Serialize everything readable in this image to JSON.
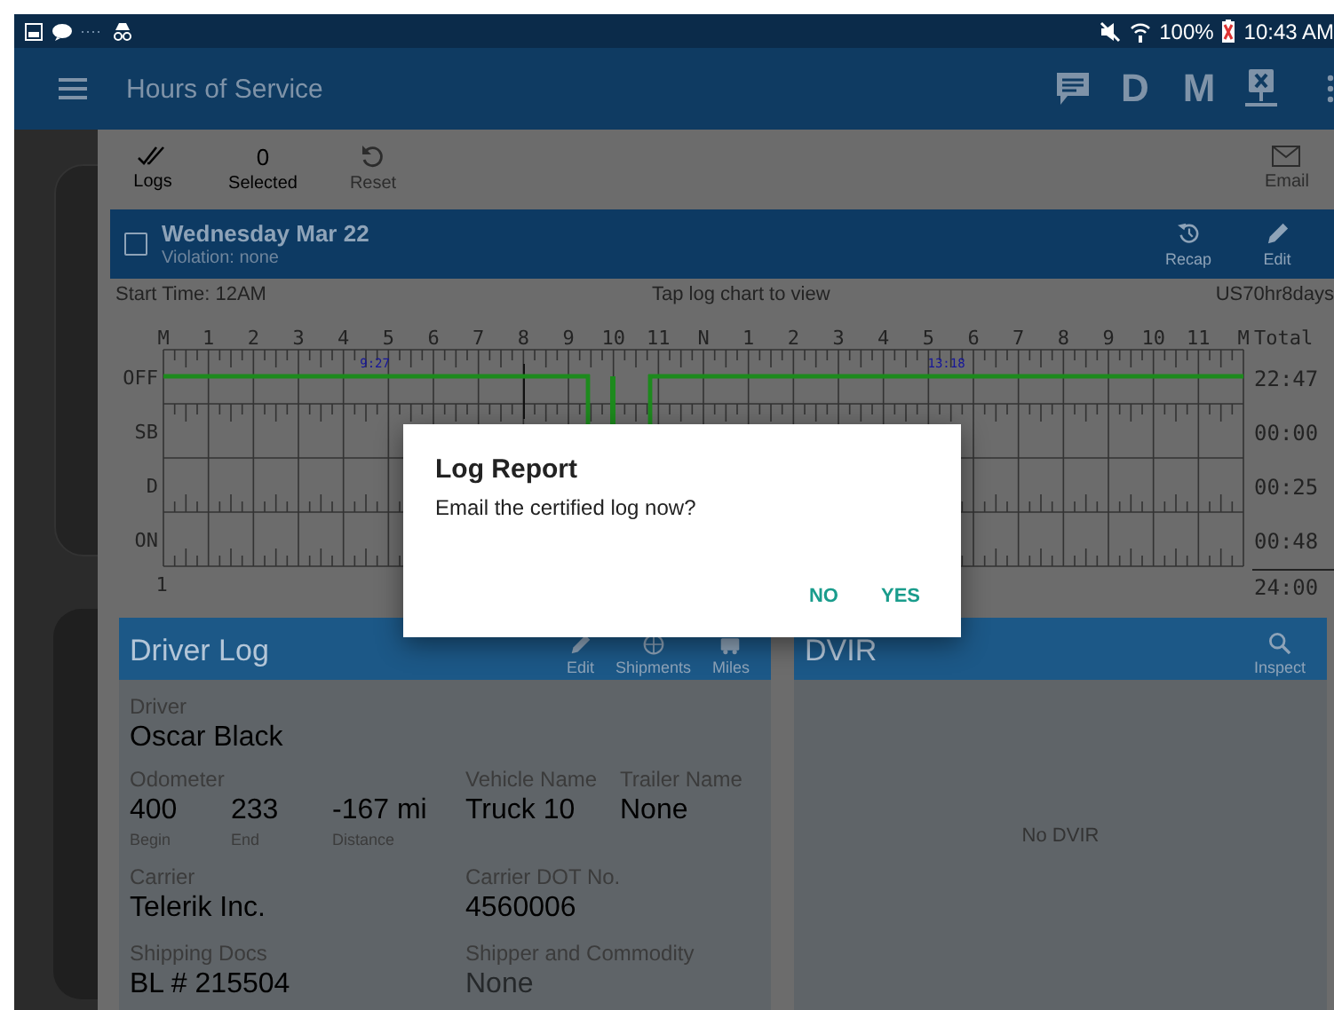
{
  "status_bar": {
    "battery": "100%",
    "time": "10:43 AM"
  },
  "app_bar": {
    "title": "Hours of Service",
    "actions": [
      "D",
      "M"
    ]
  },
  "toolbar": {
    "items": [
      {
        "label": "Logs",
        "kind": "check",
        "disabled": false
      },
      {
        "label": "Selected",
        "kind": "count",
        "count": "0",
        "disabled": false
      },
      {
        "label": "Reset",
        "kind": "reset",
        "disabled": true
      }
    ],
    "email": {
      "label": "Email",
      "disabled": true
    }
  },
  "day": {
    "title": "Wednesday Mar 22",
    "violation": "Violation: none",
    "checked": false,
    "actions": [
      {
        "label": "Recap",
        "kind": "history"
      },
      {
        "label": "Edit",
        "kind": "pencil"
      }
    ]
  },
  "log_chart": {
    "start_time": "Start Time: 12AM",
    "hint": "Tap log chart to view",
    "ruleset": "US70hr8days",
    "hours": [
      "M",
      "1",
      "2",
      "3",
      "4",
      "5",
      "6",
      "7",
      "8",
      "9",
      "10",
      "11",
      "N",
      "1",
      "2",
      "3",
      "4",
      "5",
      "6",
      "7",
      "8",
      "9",
      "10",
      "11",
      "M"
    ],
    "total_label": "Total",
    "rows": [
      {
        "label": "OFF",
        "total": "22:47"
      },
      {
        "label": "SB",
        "total": "00:00"
      },
      {
        "label": "D",
        "total": "00:25"
      },
      {
        "label": "ON",
        "total": "00:48"
      }
    ],
    "grand_total": "24:00",
    "marks": [
      "9:27",
      "13:18"
    ],
    "day_index": "1"
  },
  "driver_log": {
    "title": "Driver Log",
    "actions": [
      {
        "label": "Edit",
        "kind": "pencil"
      },
      {
        "label": "Shipments",
        "kind": "globe"
      },
      {
        "label": "Miles",
        "kind": "truck"
      }
    ],
    "driver": {
      "label": "Driver",
      "value": "Oscar Black"
    },
    "odometer": {
      "label": "Odometer",
      "readings": [
        {
          "value": "400",
          "caption": "Begin"
        },
        {
          "value": "233",
          "caption": "End"
        },
        {
          "value": "-167 mi",
          "caption": "Distance"
        }
      ]
    },
    "vehicle": {
      "label": "Vehicle Name",
      "value": "Truck 10"
    },
    "trailer": {
      "label": "Trailer Name",
      "value": "None"
    },
    "carrier": {
      "label": "Carrier",
      "value": "Telerik Inc."
    },
    "carrier_dot": {
      "label": "Carrier DOT No.",
      "value": "4560006"
    },
    "shipping_docs": {
      "label": "Shipping Docs",
      "value": "BL # 215504",
      "empty": false
    },
    "shipper": {
      "label": "Shipper and Commodity",
      "value": "None",
      "empty": true
    }
  },
  "dvir": {
    "title": "DVIR",
    "action": "Inspect",
    "empty_text": "No DVIR"
  },
  "dialog": {
    "title": "Log Report",
    "message": "Email the certified log now?",
    "buttons": [
      "NO",
      "YES"
    ]
  }
}
